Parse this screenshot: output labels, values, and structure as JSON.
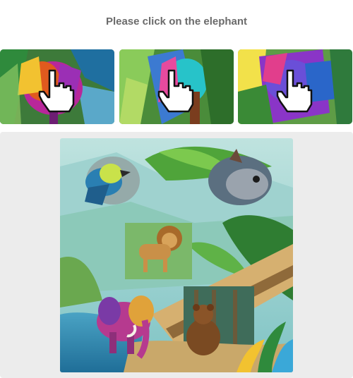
{
  "instruction": "Please click on the elephant",
  "thumbnails": [
    {
      "name": "elephant-tile-1",
      "icon": "hand-pointer-icon"
    },
    {
      "name": "elephant-tile-2",
      "icon": "hand-pointer-icon"
    },
    {
      "name": "elephant-tile-3",
      "icon": "hand-pointer-icon"
    }
  ],
  "scene": {
    "animals": [
      "parrot",
      "squirrel",
      "lion",
      "elephant",
      "bear"
    ]
  }
}
